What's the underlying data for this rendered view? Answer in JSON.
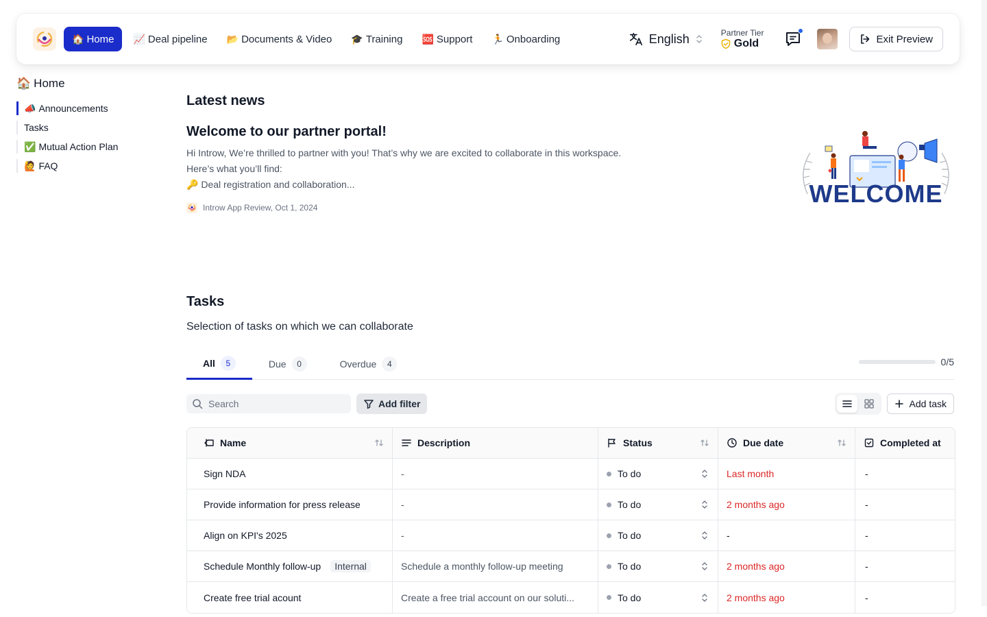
{
  "nav": {
    "items": [
      {
        "emoji": "🏠",
        "label": "Home",
        "active": true
      },
      {
        "emoji": "📈",
        "label": "Deal pipeline"
      },
      {
        "emoji": "📂",
        "label": "Documents & Video"
      },
      {
        "emoji": "🎓",
        "label": "Training"
      },
      {
        "emoji": "🆘",
        "label": "Support"
      },
      {
        "emoji": "🏃",
        "label": "Onboarding"
      }
    ],
    "language": "English",
    "tier_label": "Partner Tier",
    "tier_value": "Gold",
    "exit_label": "Exit Preview"
  },
  "sidebar": {
    "title_emoji": "🏠",
    "title": "Home",
    "items": [
      {
        "emoji": "📣",
        "label": "Announcements",
        "active": true
      },
      {
        "emoji": "",
        "label": "Tasks"
      },
      {
        "emoji": "✅",
        "label": "Mutual Action Plan"
      },
      {
        "emoji": "🙋",
        "label": "FAQ"
      }
    ]
  },
  "news": {
    "section_title": "Latest news",
    "title": "Welcome to our partner portal!",
    "line1": "Hi Introw, We’re thrilled to partner with you! That’s why we are excited to collaborate in this workspace.",
    "line2": "Here’s what you’ll find:",
    "line3_emoji": "🔑",
    "line3": "Deal registration and collaboration...",
    "meta": "Introw App Review, Oct 1, 2024",
    "image_text": "WELCOME"
  },
  "tasks": {
    "section_title": "Tasks",
    "subtitle": "Selection of tasks on which we can collaborate",
    "tabs": [
      {
        "label": "All",
        "count": "5",
        "active": true
      },
      {
        "label": "Due",
        "count": "0"
      },
      {
        "label": "Overdue",
        "count": "4"
      }
    ],
    "progress_text": "0/5",
    "progress_fraction": 0,
    "search_placeholder": "Search",
    "filter_label": "Add filter",
    "add_task_label": "Add task",
    "columns": {
      "name": "Name",
      "description": "Description",
      "status": "Status",
      "due": "Due date",
      "completed": "Completed at"
    },
    "rows": [
      {
        "name": "Sign NDA",
        "tag": "",
        "description": "-",
        "status": "To do",
        "due": "Last month",
        "completed": "-"
      },
      {
        "name": "Provide information for press release",
        "tag": "",
        "description": "-",
        "status": "To do",
        "due": "2 months ago",
        "completed": "-"
      },
      {
        "name": "Align on KPI's 2025",
        "tag": "",
        "description": "-",
        "status": "To do",
        "due": "-",
        "completed": "-"
      },
      {
        "name": "Schedule Monthly follow-up",
        "tag": "Internal",
        "description": "Schedule a monthly follow-up meeting",
        "status": "To do",
        "due": "2 months ago",
        "completed": "-"
      },
      {
        "name": "Create free trial acount",
        "tag": "",
        "description": "Create a free trial account on our soluti...",
        "status": "To do",
        "due": "2 months ago",
        "completed": "-"
      }
    ]
  },
  "colors": {
    "accent": "#1a2cc9",
    "overdue": "#dc2626",
    "gold": "#eab308"
  }
}
